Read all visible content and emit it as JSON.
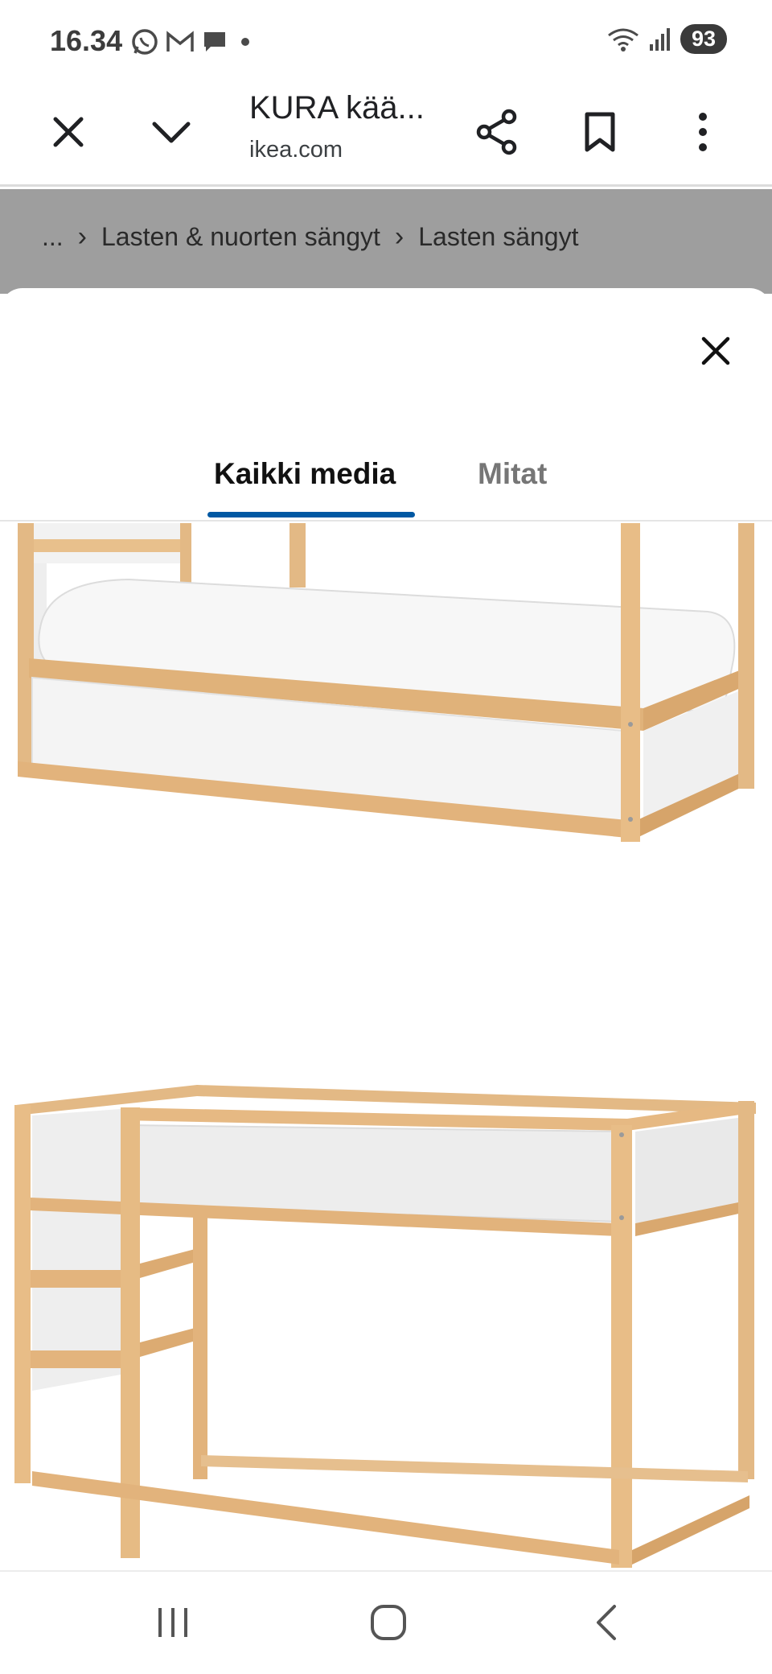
{
  "status_bar": {
    "time": "16.34",
    "battery": "93",
    "icons_left": [
      "whatsapp-icon",
      "gmail-icon",
      "chat-icon",
      "dot-icon"
    ],
    "icons_right": [
      "wifi-icon",
      "signal-icon",
      "battery-icon"
    ]
  },
  "toolbar": {
    "title": "KURA kää...",
    "url": "ikea.com",
    "icons": [
      "close-icon",
      "chevron-down-icon",
      "share-icon",
      "bookmark-icon",
      "more-vert-icon"
    ]
  },
  "breadcrumb": {
    "ellipsis": "...",
    "items": [
      "Lasten & nuorten sängyt",
      "Lasten sängyt"
    ]
  },
  "modal": {
    "tabs": [
      {
        "label": "Kaikki media",
        "active": true
      },
      {
        "label": "Mitat",
        "active": false
      }
    ],
    "accent_color": "#0058a3",
    "media": [
      "bed-low-position-image",
      "bed-loft-position-image"
    ]
  },
  "navbar": {
    "icons": [
      "recent-apps-icon",
      "home-icon",
      "back-icon"
    ]
  }
}
